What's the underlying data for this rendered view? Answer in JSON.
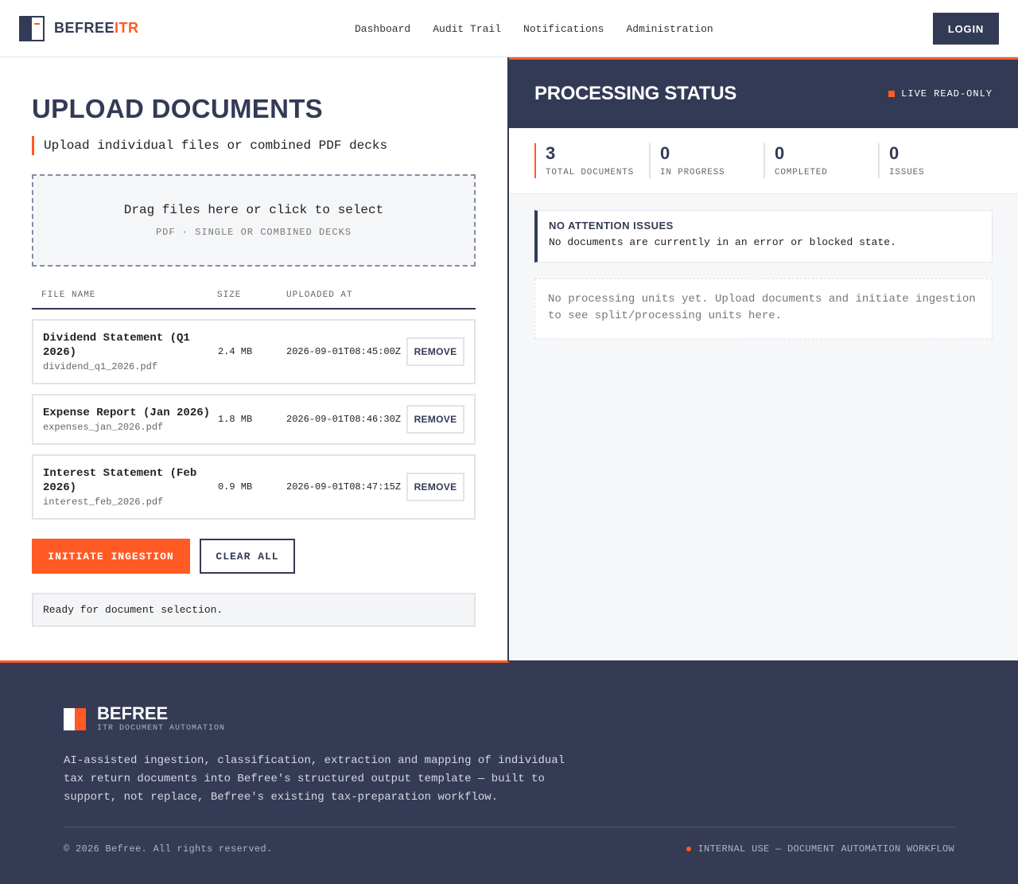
{
  "header": {
    "brand_primary": "BEFREE",
    "brand_accent": "ITR",
    "nav": [
      "Dashboard",
      "Audit Trail",
      "Notifications",
      "Administration"
    ],
    "login_label": "LOGIN"
  },
  "upload": {
    "title": "UPLOAD DOCUMENTS",
    "subtitle": "Upload individual files or combined PDF decks",
    "dropzone_title": "Drag files here or click to select",
    "dropzone_sub": "PDF · SINGLE OR COMBINED DECKS",
    "columns": [
      "FILE NAME",
      "SIZE",
      "UPLOADED AT"
    ],
    "files": [
      {
        "title": "Dividend Statement (Q1 2026)",
        "filename": "dividend_q1_2026.pdf",
        "size": "2.4 MB",
        "uploaded": "2026-09-01T08:45:00Z",
        "remove": "REMOVE"
      },
      {
        "title": "Expense Report (Jan 2026)",
        "filename": "expenses_jan_2026.pdf",
        "size": "1.8 MB",
        "uploaded": "2026-09-01T08:46:30Z",
        "remove": "REMOVE"
      },
      {
        "title": "Interest Statement (Feb 2026)",
        "filename": "interest_feb_2026.pdf",
        "size": "0.9 MB",
        "uploaded": "2026-09-01T08:47:15Z",
        "remove": "REMOVE"
      }
    ],
    "initiate_label": "INITIATE INGESTION",
    "clear_label": "CLEAR ALL",
    "status_message": "Ready for document selection."
  },
  "processing": {
    "title": "PROCESSING STATUS",
    "live_label": "LIVE READ-ONLY",
    "stats": [
      {
        "value": "3",
        "label": "TOTAL DOCUMENTS"
      },
      {
        "value": "0",
        "label": "IN PROGRESS"
      },
      {
        "value": "0",
        "label": "COMPLETED"
      },
      {
        "value": "0",
        "label": "ISSUES"
      }
    ],
    "alert_title": "NO ATTENTION ISSUES",
    "alert_text": "No documents are currently in an error or blocked state.",
    "empty_text": "No processing units yet. Upload documents and initiate ingestion to see split/processing units here."
  },
  "footer": {
    "brand": "BEFREE",
    "tagline": "ITR DOCUMENT AUTOMATION",
    "description": "AI-assisted ingestion, classification, extraction and mapping of individual tax return documents into Befree's structured output template — built to support, not replace, Befree's existing tax-preparation workflow.",
    "copyright": "© 2026 Befree. All rights reserved.",
    "internal": "INTERNAL USE — DOCUMENT AUTOMATION WORKFLOW"
  },
  "colors": {
    "navy": "#333a55",
    "accent": "#ff5a24"
  }
}
